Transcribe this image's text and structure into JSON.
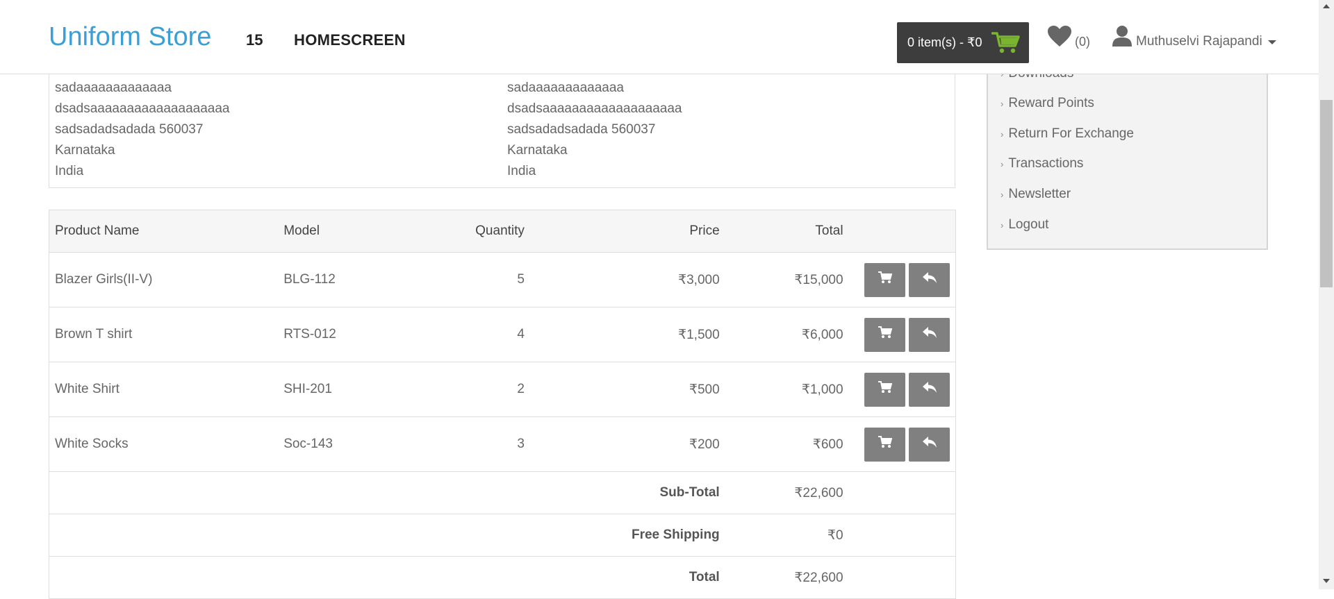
{
  "header": {
    "brand": "Uniform Store",
    "nav_number": "15",
    "nav_home": "HOMESCREEN",
    "cart_label": "0 item(s) - ₹0",
    "wishlist_count": "(0)",
    "user_name": "Muthuselvi Rajapandi"
  },
  "address": {
    "payment": [
      "sadaaaaaaaaaaaaa",
      "dsadsaaaaaaaaaaaaaaaaaaa",
      "sadsadadsadada 560037",
      "Karnataka",
      "India"
    ],
    "shipping": [
      "sadaaaaaaaaaaaaa",
      "dsadsaaaaaaaaaaaaaaaaaaa",
      "sadsadadsadada 560037",
      "Karnataka",
      "India"
    ]
  },
  "table": {
    "headers": {
      "product": "Product Name",
      "model": "Model",
      "quantity": "Quantity",
      "price": "Price",
      "total": "Total"
    },
    "rows": [
      {
        "product": "Blazer Girls(II-V)",
        "model": "BLG-112",
        "quantity": "5",
        "price": "₹3,000",
        "total": "₹15,000"
      },
      {
        "product": "Brown T shirt",
        "model": "RTS-012",
        "quantity": "4",
        "price": "₹1,500",
        "total": "₹6,000"
      },
      {
        "product": "White Shirt",
        "model": "SHI-201",
        "quantity": "2",
        "price": "₹500",
        "total": "₹1,000"
      },
      {
        "product": "White Socks",
        "model": "Soc-143",
        "quantity": "3",
        "price": "₹200",
        "total": "₹600"
      }
    ],
    "summary": [
      {
        "label": "Sub-Total",
        "value": "₹22,600"
      },
      {
        "label": "Free Shipping",
        "value": "₹0"
      },
      {
        "label": "Total",
        "value": "₹22,600"
      }
    ]
  },
  "sidebar": {
    "items": [
      {
        "label": "Downloads"
      },
      {
        "label": "Reward Points"
      },
      {
        "label": "Return For Exchange"
      },
      {
        "label": "Transactions"
      },
      {
        "label": "Newsletter"
      },
      {
        "label": "Logout"
      }
    ]
  },
  "colors": {
    "brand": "#3a9fd6",
    "cart_button": "#3d3d3d",
    "cart_icon": "#7ab52e",
    "action_button": "#808080"
  }
}
